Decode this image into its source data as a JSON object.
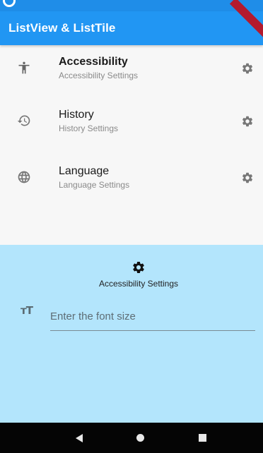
{
  "app_bar": {
    "title": "ListView & ListTile",
    "color": "#2196f3"
  },
  "list": {
    "items": [
      {
        "title": "Accessibility",
        "subtitle": "Accessibility Settings",
        "lead_icon": "accessibility-icon",
        "trail_icon": "gear-icon",
        "title_bold": true
      },
      {
        "title": "History",
        "subtitle": "History Settings",
        "lead_icon": "history-icon",
        "trail_icon": "gear-icon",
        "title_bold": false
      },
      {
        "title": "Language",
        "subtitle": "Language Settings",
        "lead_icon": "globe-icon",
        "trail_icon": "gear-icon",
        "title_bold": false
      }
    ]
  },
  "panel": {
    "heading": "Accessibility Settings",
    "icon": "gear-icon",
    "background": "#b3e5fc",
    "font_field": {
      "icon": "text-size-icon",
      "placeholder": "Enter the font size",
      "value": ""
    }
  },
  "nav_bar": {
    "buttons": [
      "back",
      "home",
      "recent-apps"
    ]
  }
}
